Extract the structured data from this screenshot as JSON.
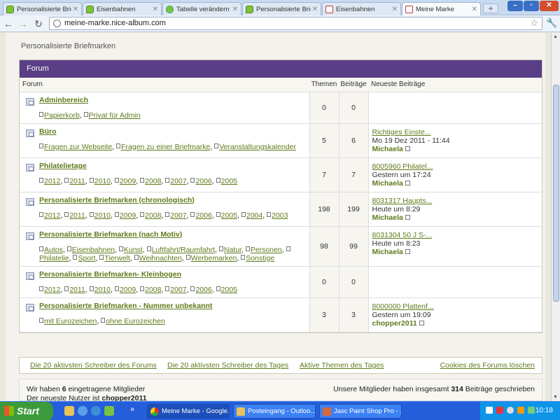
{
  "browser": {
    "tabs": [
      {
        "title": "Personalisierte Briefm",
        "icon": "bubble"
      },
      {
        "title": "Eisenbahnen",
        "icon": "bubble"
      },
      {
        "title": "Tabelle verändern",
        "icon": "table"
      },
      {
        "title": "Personalisierte Briefm",
        "icon": "bubble"
      },
      {
        "title": "Eisenbahnen",
        "icon": "stamp"
      },
      {
        "title": "Meine Marke",
        "icon": "stamp"
      }
    ],
    "new_tab": "+",
    "url": "meine-marke.nice-album.com"
  },
  "page": {
    "breadcrumb": "Personalisierte Briefmarken",
    "forum_title": "Forum",
    "columns": {
      "forum": "Forum",
      "themen": "Themen",
      "beitraege": "Beiträge",
      "latest": "Neueste Beiträge"
    },
    "rows": [
      {
        "name": "Adminbereich",
        "subs": [
          "Papierkorb",
          "Privat für Admin"
        ],
        "themen": "0",
        "beitraege": "0",
        "latest": null
      },
      {
        "name": "Büro",
        "subs": [
          "Fragen zur Webseite",
          "Fragen zu einer Briefmarke",
          "Veranstaltungskalender"
        ],
        "themen": "5",
        "beitraege": "6",
        "latest": {
          "post": "Richtiges Einste...",
          "date": "Mo 19 Dez 2011 - 11:44",
          "author": "Michaela"
        }
      },
      {
        "name": "Philatelietage",
        "subs": [
          "2012",
          "2011",
          "2010",
          "2009",
          "2008",
          "2007",
          "2006",
          "2005"
        ],
        "themen": "7",
        "beitraege": "7",
        "latest": {
          "post": "8005960 Philatel...",
          "date": "Gestern um 17:24",
          "author": "Michaela"
        }
      },
      {
        "name": "Personalisierte Briefmarken (chronologisch)",
        "subs": [
          "2012",
          "2011",
          "2010",
          "2009",
          "2008",
          "2007",
          "2006",
          "2005",
          "2004",
          "2003"
        ],
        "themen": "198",
        "beitraege": "199",
        "latest": {
          "post": "8031317 Haupts...",
          "date": "Heute um 8:29",
          "author": "Michaela"
        }
      },
      {
        "name": "Personalisierte Briefmarken (nach Motiv)",
        "subs": [
          "Autos",
          "Eisenbahnen",
          "Kunst",
          "Luftfahrt/Raumfahrt",
          "Natur",
          "Personen",
          "Philatelie",
          "Sport",
          "Tierwelt",
          "Weihnachten",
          "Werbemarken",
          "Sonstige"
        ],
        "themen": "98",
        "beitraege": "99",
        "latest": {
          "post": "8031304 50 J S-...",
          "date": "Heute um 8:23",
          "author": "Michaela"
        }
      },
      {
        "name": "Personalisierte Briefmarken- Kleinbogen",
        "subs": [
          "2012",
          "2011",
          "2010",
          "2009",
          "2008",
          "2007",
          "2006",
          "2005"
        ],
        "themen": "0",
        "beitraege": "0",
        "latest": null
      },
      {
        "name": "Personalisierte Briefmarken - Nummer unbekannt",
        "subs": [
          "mit Eurozeichen",
          "ohne Eurozeichen"
        ],
        "themen": "3",
        "beitraege": "3",
        "latest": {
          "post": "8000000 Plattenf...",
          "date": "Gestern um 19:09",
          "author": "chopper2011"
        }
      }
    ],
    "links": {
      "writers_forum": "Die 20 aktivsten Schreiber des Forums",
      "writers_day": "Die 20 aktivsten Schreiber des Tages",
      "active_topics": "Aktive Themen des Tages",
      "delete_cookies": "Cookies des Forums löschen"
    },
    "stats": {
      "members_pre": "Wir haben ",
      "members_count": "6",
      "members_post": " eingetragene Mitglieder",
      "newest_pre": "Der neueste Nutzer ist ",
      "newest_user": "chopper2011",
      "posts_pre": "Unsere Mitglieder haben insgesamt ",
      "posts_count": "314",
      "posts_post": " Beiträge geschrieben"
    }
  },
  "taskbar": {
    "start": "Start",
    "tasks": [
      "Meine Marke - Google...",
      "Posteingang - Outloo...",
      "Jasc Paint Shop Pro - ..."
    ],
    "more": "»",
    "clock": "10:18"
  },
  "colors": {
    "forum_header": "#5a3e86",
    "link": "#5f7a1b",
    "taskbar": "#245edb"
  }
}
